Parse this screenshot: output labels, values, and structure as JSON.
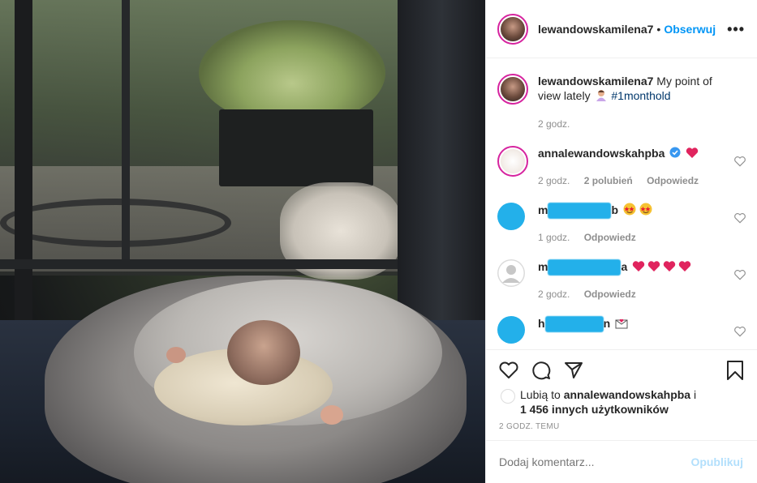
{
  "post": {
    "username": "lewandowskamilena7",
    "dot": "•",
    "follow_label": "Obserwuj",
    "more_label": "•••"
  },
  "caption": {
    "username": "lewandowskamilena7",
    "text": "My point of view lately",
    "hashtag": "#1monthold",
    "time": "2 godz."
  },
  "comments": [
    {
      "username": "annalewandowskahpba",
      "text": "",
      "time": "2 godz.",
      "likes": "2 polubień",
      "reply": "Odpowiedz"
    },
    {
      "username_start": "m",
      "username_end": "b",
      "time": "1 godz.",
      "reply": "Odpowiedz"
    },
    {
      "username_start": "m",
      "username_end": "a",
      "time": "2 godz.",
      "reply": "Odpowiedz"
    },
    {
      "username_start": "h",
      "username_end": "n"
    }
  ],
  "likes": {
    "prefix": "Lubią to",
    "user": "annalewandowskahpba",
    "and": "i",
    "others": "1 456 innych użytkowników"
  },
  "timestamp": "2 GODZ. TEMU",
  "add_comment": {
    "placeholder": "Dodaj komentarz...",
    "post_label": "Opublikuj"
  },
  "colors": {
    "accent": "#0095f6",
    "post_disabled": "#b2dffc",
    "redaction": "#23b0ea"
  }
}
